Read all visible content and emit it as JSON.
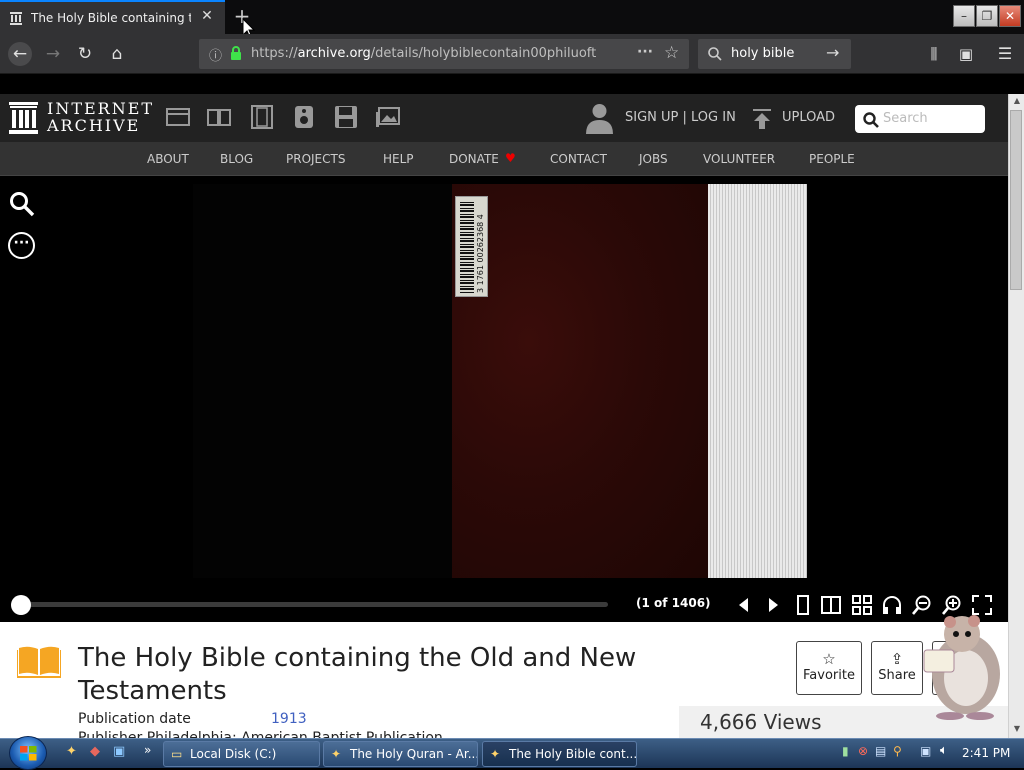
{
  "browser": {
    "tab_title": "The Holy Bible containing the O",
    "new_tab_label": "+",
    "url_prefix": "https://",
    "url_host": "archive.org",
    "url_path": "/details/holybiblecontain00philuoft",
    "search_value": "holy bible"
  },
  "ia_header": {
    "logo_line1": "INTERNET",
    "logo_line2": "ARCHIVE",
    "signup": "SIGN UP | LOG IN",
    "upload": "UPLOAD",
    "search_placeholder": "Search",
    "nav": [
      "ABOUT",
      "BLOG",
      "PROJECTS",
      "HELP",
      "DONATE",
      "CONTACT",
      "JOBS",
      "VOLUNTEER",
      "PEOPLE"
    ]
  },
  "viewer": {
    "page_count": "(1 of 1406)",
    "barcode_text": "3 1761 00262368 4",
    "more_glyph": "···"
  },
  "details": {
    "title": "The Holy Bible containing the Old and New Testaments",
    "pubdate_label": "Publication date",
    "pubdate_value": "1913",
    "publisher_partial": "Publisher        Philadelphia: American Baptist Publication",
    "favorite_label": "Favorite",
    "share_label": "Share",
    "views": "4,666 Views"
  },
  "taskbar": {
    "items": [
      "Local Disk (C:)",
      "The Holy Quran - Ar...",
      "The Holy Bible cont..."
    ],
    "clock": "2:41 PM"
  },
  "colors": {
    "accent": "#0a84ff",
    "donate_heart": "#e00",
    "link": "#4060c0"
  }
}
